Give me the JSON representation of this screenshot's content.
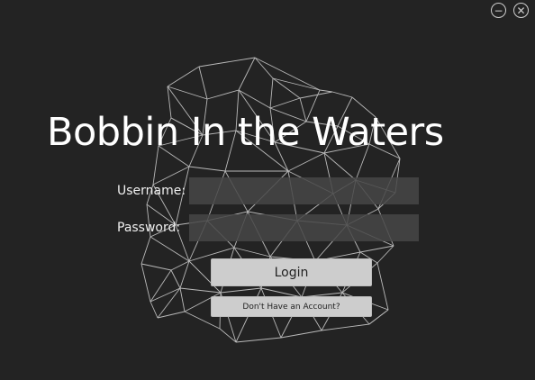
{
  "window": {
    "minimize_icon": "minus-circle-icon",
    "close_icon": "close-circle-icon"
  },
  "app": {
    "title": "Bobbin In the Waters"
  },
  "form": {
    "username_label": "Username:",
    "username_value": "",
    "password_label": "Password:",
    "password_value": "",
    "login_label": "Login",
    "signup_label": "Don't Have an Account?"
  },
  "colors": {
    "background": "#232323",
    "mesh_line": "#cfcfcf",
    "field_fill": "#464646",
    "button_fill": "#cdcdcd"
  }
}
